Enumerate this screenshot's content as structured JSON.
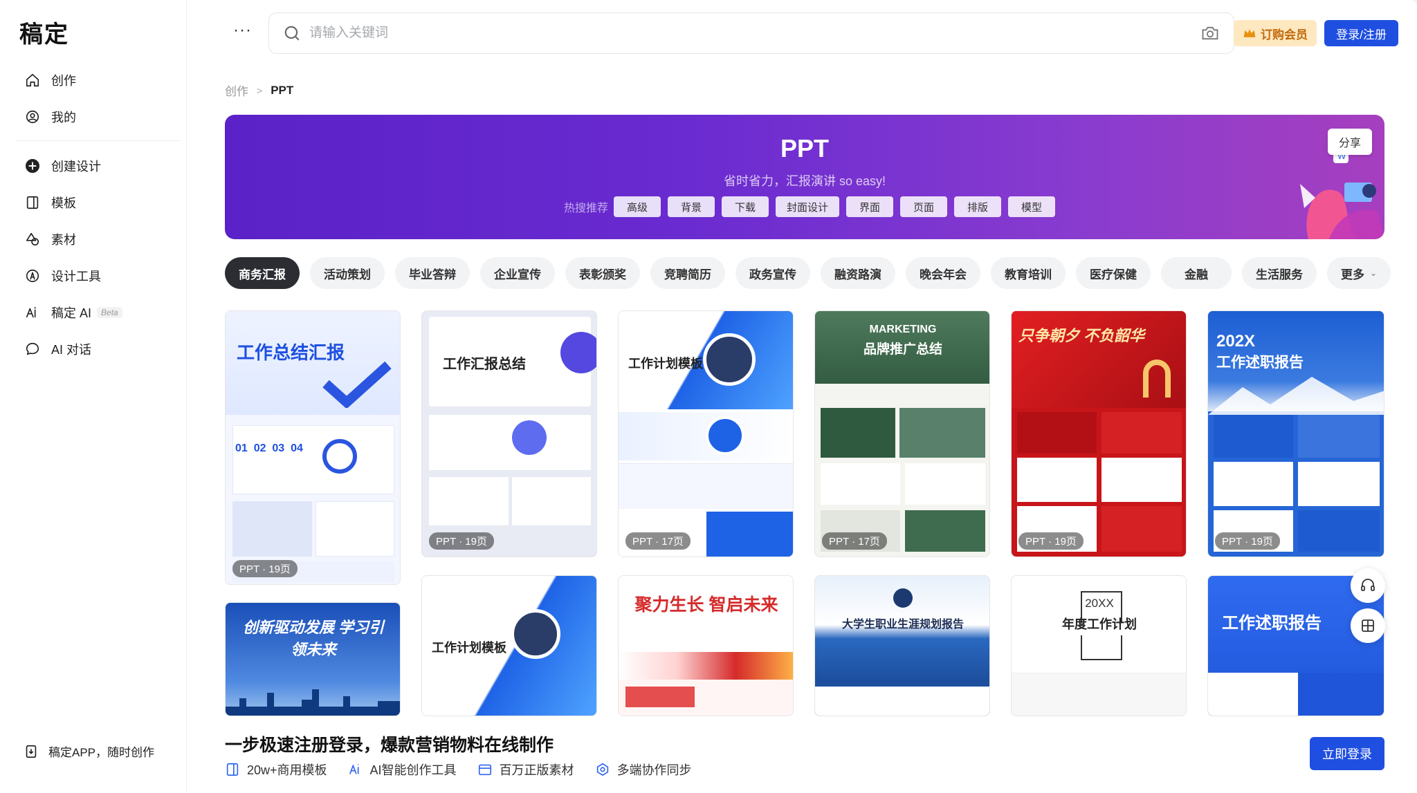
{
  "app": {
    "logo": "稿定"
  },
  "sidebar": {
    "primary": [
      {
        "label": "创作",
        "icon": "home-icon"
      },
      {
        "label": "我的",
        "icon": "user-icon"
      }
    ],
    "secondary": [
      {
        "label": "创建设计",
        "icon": "plus-circle-icon"
      },
      {
        "label": "模板",
        "icon": "template-icon"
      },
      {
        "label": "素材",
        "icon": "shapes-icon"
      },
      {
        "label": "设计工具",
        "icon": "tools-icon"
      },
      {
        "label": "稿定 AI",
        "icon": "ai-icon",
        "badge": "Beta"
      },
      {
        "label": "AI 对话",
        "icon": "chat-icon"
      }
    ],
    "app_download": "稿定APP，随时创作"
  },
  "header": {
    "more": "···",
    "search_placeholder": "请输入关键词",
    "vip_label": "订购会员",
    "login_label": "登录/注册"
  },
  "breadcrumb": {
    "root": "创作",
    "sep": ">",
    "current": "PPT"
  },
  "banner": {
    "title": "PPT",
    "subtitle": "省时省力，汇报演讲 so easy!",
    "hot_label": "热搜推荐",
    "hot_tags": [
      "高级",
      "背景",
      "下载",
      "封面设计",
      "界面",
      "页面",
      "排版",
      "模型"
    ],
    "share_label": "分享"
  },
  "categories": {
    "items": [
      "商务汇报",
      "活动策划",
      "毕业答辩",
      "企业宣传",
      "表彰颁奖",
      "竞聘简历",
      "政务宣传",
      "融资路演",
      "晚会年会",
      "教育培训",
      "医疗保健",
      "金融",
      "生活服务"
    ],
    "more": "更多",
    "active_index": 0
  },
  "templates_row1": [
    {
      "title": "工作总结汇报",
      "badge": "PPT · 19页",
      "theme": "#2f5ef0",
      "bg": "#eef3ff"
    },
    {
      "title": "工作汇报总结",
      "badge": "PPT · 19页",
      "theme": "#4a56e8",
      "bg": "#e9ebf5"
    },
    {
      "title": "工作计划模板",
      "badge": "PPT · 17页",
      "theme": "#1e63e6",
      "bg": "#f4f7ff"
    },
    {
      "title": "品牌推广总结",
      "title_en": "MARKETING",
      "badge": "PPT · 17页",
      "theme": "#3f6b4f",
      "bg": "#f2f2ef"
    },
    {
      "title": "只争朝夕 不负韶华",
      "badge": "PPT · 19页",
      "theme": "#d9201c",
      "bg": "#c8151a"
    },
    {
      "title": "工作述职报告",
      "title_top": "202X",
      "badge": "PPT · 19页",
      "theme": "#1d62d8",
      "bg": "#2565d6"
    }
  ],
  "templates_row2": [
    {
      "title": "创新驱动发展 学习引领未来",
      "theme": "#1a4fb8"
    },
    {
      "title": "工作计划模板",
      "theme": "#1e63e6"
    },
    {
      "title": "聚力生长 智启未来",
      "theme": "#d52b2b"
    },
    {
      "title": "大学生职业生涯规划报告",
      "theme": "#1d4f9e"
    },
    {
      "title": "年度工作计划",
      "title_top": "20XX",
      "theme": "#333333"
    },
    {
      "title": "工作述职报告",
      "theme": "#2f6bf0"
    }
  ],
  "bottom_bar": {
    "title": "一步极速注册登录，爆款营销物料在线制作",
    "features": [
      {
        "label": "20w+商用模板",
        "icon": "template-icon"
      },
      {
        "label": "AI智能创作工具",
        "icon": "ai-icon"
      },
      {
        "label": "百万正版素材",
        "icon": "image-icon"
      },
      {
        "label": "多端协作同步",
        "icon": "sync-icon"
      }
    ],
    "cta": "立即登录"
  }
}
